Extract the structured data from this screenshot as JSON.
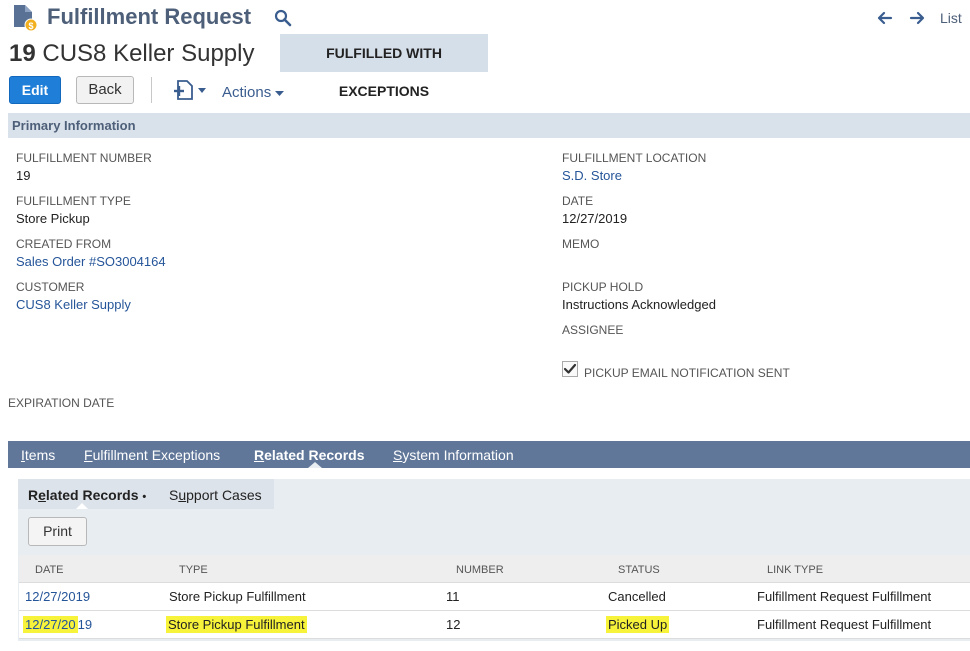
{
  "header": {
    "title": "Fulfillment Request",
    "record_number": "19",
    "record_name": "CUS8 Keller Supply",
    "status": "FULFILLED WITH EXCEPTIONS",
    "nav_list": "List"
  },
  "toolbar": {
    "edit_label": "Edit",
    "back_label": "Back",
    "actions_label": "Actions"
  },
  "primary_section": {
    "title": "Primary Information",
    "fulfillment_number_label": "FULFILLMENT NUMBER",
    "fulfillment_number": "19",
    "fulfillment_type_label": "FULFILLMENT TYPE",
    "fulfillment_type": "Store Pickup",
    "created_from_label": "CREATED FROM",
    "created_from": "Sales Order #SO3004164",
    "customer_label": "CUSTOMER",
    "customer": "CUS8 Keller Supply",
    "expiration_date_label": "EXPIRATION DATE",
    "fulfillment_location_label": "FULFILLMENT LOCATION",
    "fulfillment_location": "S.D. Store",
    "date_label": "DATE",
    "date": "12/27/2019",
    "memo_label": "MEMO",
    "pickup_hold_label": "PICKUP HOLD",
    "pickup_hold": "Instructions Acknowledged",
    "assignee_label": "ASSIGNEE",
    "pickup_email_label": "PICKUP EMAIL NOTIFICATION SENT",
    "pickup_email_checked": true
  },
  "tabs": {
    "items_first": "I",
    "items_rest": "tems",
    "exceptions_first": "F",
    "exceptions_rest": "ulfillment Exceptions",
    "related_first": "R",
    "related_rest": "elated Records",
    "system_first": "S",
    "system_rest": "ystem Information"
  },
  "subtabs": {
    "related_first": "R",
    "related_second": "e",
    "related_rest": "lated Records",
    "related_bullet": "•",
    "support_first": "S",
    "support_second": "u",
    "support_rest": "pport Cases"
  },
  "related_records": {
    "print_label": "Print",
    "columns": [
      "DATE",
      "TYPE",
      "NUMBER",
      "STATUS",
      "LINK TYPE"
    ],
    "rows": [
      {
        "date": "12/27/2019",
        "type": "Store Pickup Fulfillment",
        "number": "11",
        "status": "Cancelled",
        "link_type": "Fulfillment Request Fulfillment"
      },
      {
        "date_hl": "12/27/20",
        "date_rest": "19",
        "type": "Store Pickup Fulfillment",
        "number": "12",
        "status": "Picked Up",
        "link_type": "Fulfillment Request Fulfillment"
      }
    ]
  },
  "colors": {
    "accent": "#1f7fd8",
    "header_text": "#4d5f79",
    "tab_bar": "#607799",
    "highlight": "#f7f23a",
    "link": "#255599"
  }
}
